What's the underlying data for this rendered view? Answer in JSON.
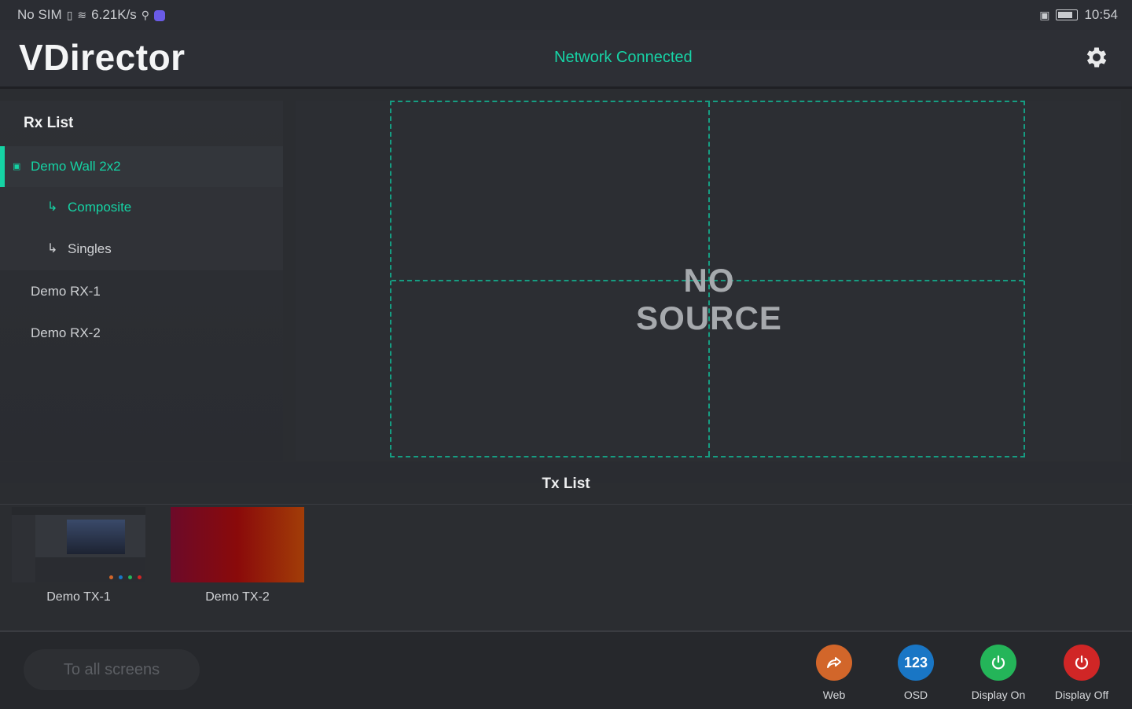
{
  "status_bar": {
    "sim": "No SIM",
    "speed": "6.21K/s",
    "time": "10:54"
  },
  "header": {
    "app_name": "VDirector",
    "network_status": "Network Connected"
  },
  "rx_list": {
    "title": "Rx List",
    "items": [
      {
        "label": "Demo Wall 2x2",
        "active": true
      },
      {
        "label": "Composite",
        "sub": true,
        "selected": true
      },
      {
        "label": "Singles",
        "sub": true
      },
      {
        "label": "Demo RX-1"
      },
      {
        "label": "Demo RX-2"
      }
    ]
  },
  "preview": {
    "message": "NO SOURCE"
  },
  "tx_list": {
    "title": "Tx List",
    "items": [
      {
        "label": "Demo TX-1"
      },
      {
        "label": "Demo TX-2"
      }
    ]
  },
  "bottom_bar": {
    "to_all_label": "To all screens",
    "actions": [
      {
        "label": "Web",
        "icon": "share-icon",
        "color": "#d2662a"
      },
      {
        "label": "OSD",
        "icon": "123",
        "color": "#1976c5"
      },
      {
        "label": "Display On",
        "icon": "power-icon",
        "color": "#24b559"
      },
      {
        "label": "Display Off",
        "icon": "power-icon",
        "color": "#d02626"
      }
    ]
  },
  "colors": {
    "accent": "#15d3a4",
    "background": "#2b2d31"
  }
}
